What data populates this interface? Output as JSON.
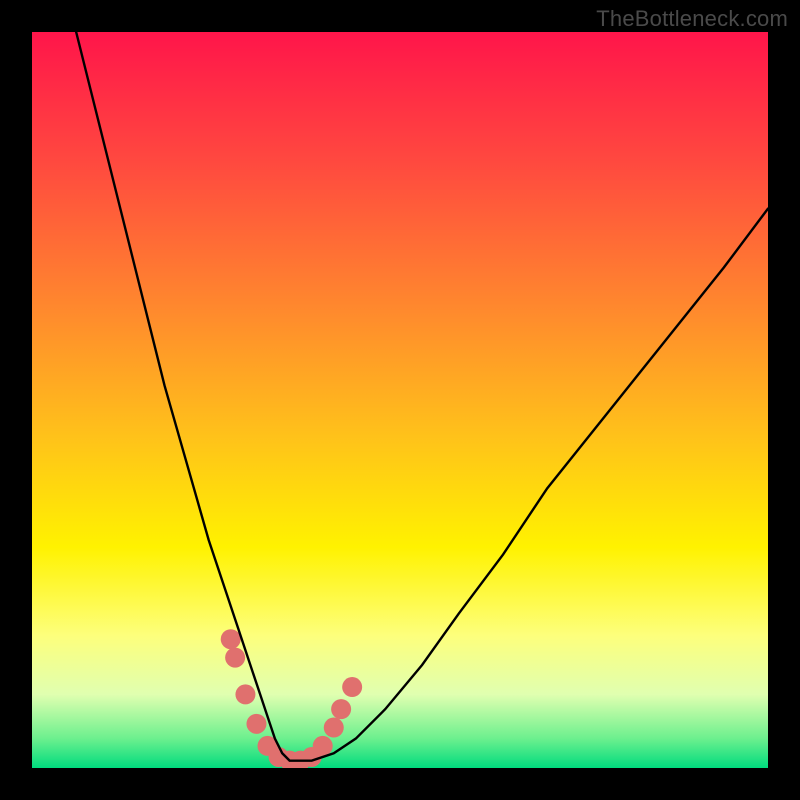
{
  "watermark": "TheBottleneck.com",
  "chart_data": {
    "type": "line",
    "title": "",
    "xlabel": "",
    "ylabel": "",
    "xlim": [
      0,
      100
    ],
    "ylim": [
      0,
      100
    ],
    "grid": false,
    "legend": false,
    "background": {
      "gradient_stops": [
        {
          "pct": 0,
          "color": "#ff154a"
        },
        {
          "pct": 18,
          "color": "#ff4a3f"
        },
        {
          "pct": 38,
          "color": "#ff8a2d"
        },
        {
          "pct": 55,
          "color": "#ffc21a"
        },
        {
          "pct": 70,
          "color": "#fff200"
        },
        {
          "pct": 82,
          "color": "#fdff7c"
        },
        {
          "pct": 90,
          "color": "#e0ffb0"
        },
        {
          "pct": 96,
          "color": "#6cf08e"
        },
        {
          "pct": 100,
          "color": "#00db7e"
        }
      ]
    },
    "series": [
      {
        "name": "bottleneck-curve",
        "color": "#000000",
        "x": [
          6,
          8,
          10,
          12,
          14,
          16,
          18,
          20,
          22,
          24,
          26,
          28,
          30,
          31,
          32,
          33,
          34,
          35,
          36,
          38,
          41,
          44,
          48,
          53,
          58,
          64,
          70,
          78,
          86,
          94,
          100
        ],
        "y": [
          100,
          92,
          84,
          76,
          68,
          60,
          52,
          45,
          38,
          31,
          25,
          19,
          13,
          10,
          7,
          4,
          2,
          1,
          1,
          1,
          2,
          4,
          8,
          14,
          21,
          29,
          38,
          48,
          58,
          68,
          76
        ]
      }
    ],
    "markers": {
      "name": "highlight-points",
      "color": "#e0706e",
      "x": [
        27.0,
        27.6,
        29.0,
        30.5,
        32.0,
        33.5,
        35.0,
        36.5,
        38.0,
        39.5,
        41.0,
        42.0,
        43.5
      ],
      "y": [
        17.5,
        15.0,
        10.0,
        6.0,
        3.0,
        1.5,
        1.0,
        1.0,
        1.5,
        3.0,
        5.5,
        8.0,
        11.0
      ],
      "radius": 10
    }
  }
}
